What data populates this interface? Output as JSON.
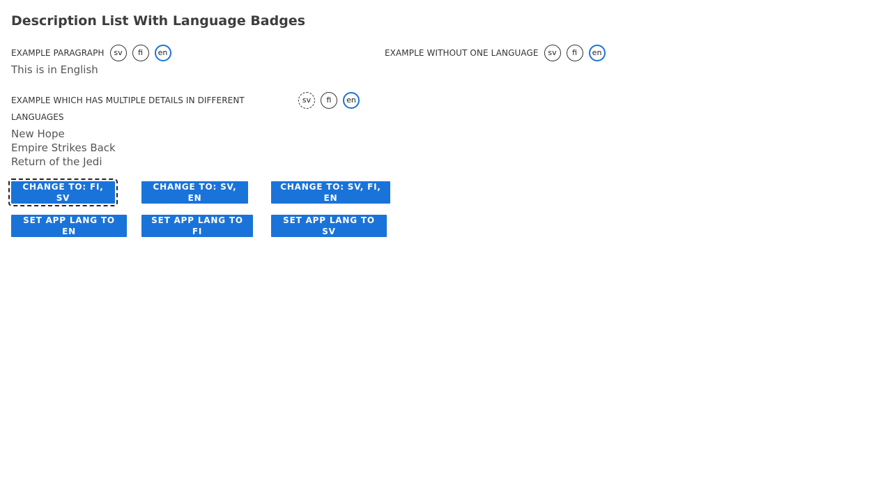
{
  "page": {
    "title": "Description List With Language Badges"
  },
  "items": [
    {
      "term": "EXAMPLE PARAGRAPH",
      "badges": [
        {
          "label": "sv",
          "state": "normal"
        },
        {
          "label": "fi",
          "state": "normal"
        },
        {
          "label": "en",
          "state": "selected"
        }
      ],
      "details": [
        "This is in English"
      ]
    },
    {
      "term": "EXAMPLE WITHOUT ONE LANGUAGE",
      "badges": [
        {
          "label": "sv",
          "state": "normal"
        },
        {
          "label": "fi",
          "state": "normal"
        },
        {
          "label": "en",
          "state": "selected"
        }
      ],
      "details": []
    },
    {
      "term": "EXAMPLE WHICH HAS MULTIPLE DETAILS IN DIFFERENT LANGUAGES",
      "badges": [
        {
          "label": "sv",
          "state": "missing"
        },
        {
          "label": "fi",
          "state": "normal"
        },
        {
          "label": "en",
          "state": "selected"
        }
      ],
      "details": [
        "New Hope",
        "Empire Strikes Back",
        "Return of the Jedi"
      ]
    }
  ],
  "buttons": {
    "change_fi_sv": "CHANGE TO: FI, SV",
    "change_sv_en": "CHANGE TO: SV, EN",
    "change_sv_fi_en": "CHANGE TO: SV, FI, EN",
    "app_lang_en": "SET APP LANG TO EN",
    "app_lang_fi": "SET APP LANG TO FI",
    "app_lang_sv": "SET APP LANG TO SV"
  },
  "colors": {
    "primary": "#1a73d9",
    "text": "#333333",
    "detail_text": "#555555"
  }
}
